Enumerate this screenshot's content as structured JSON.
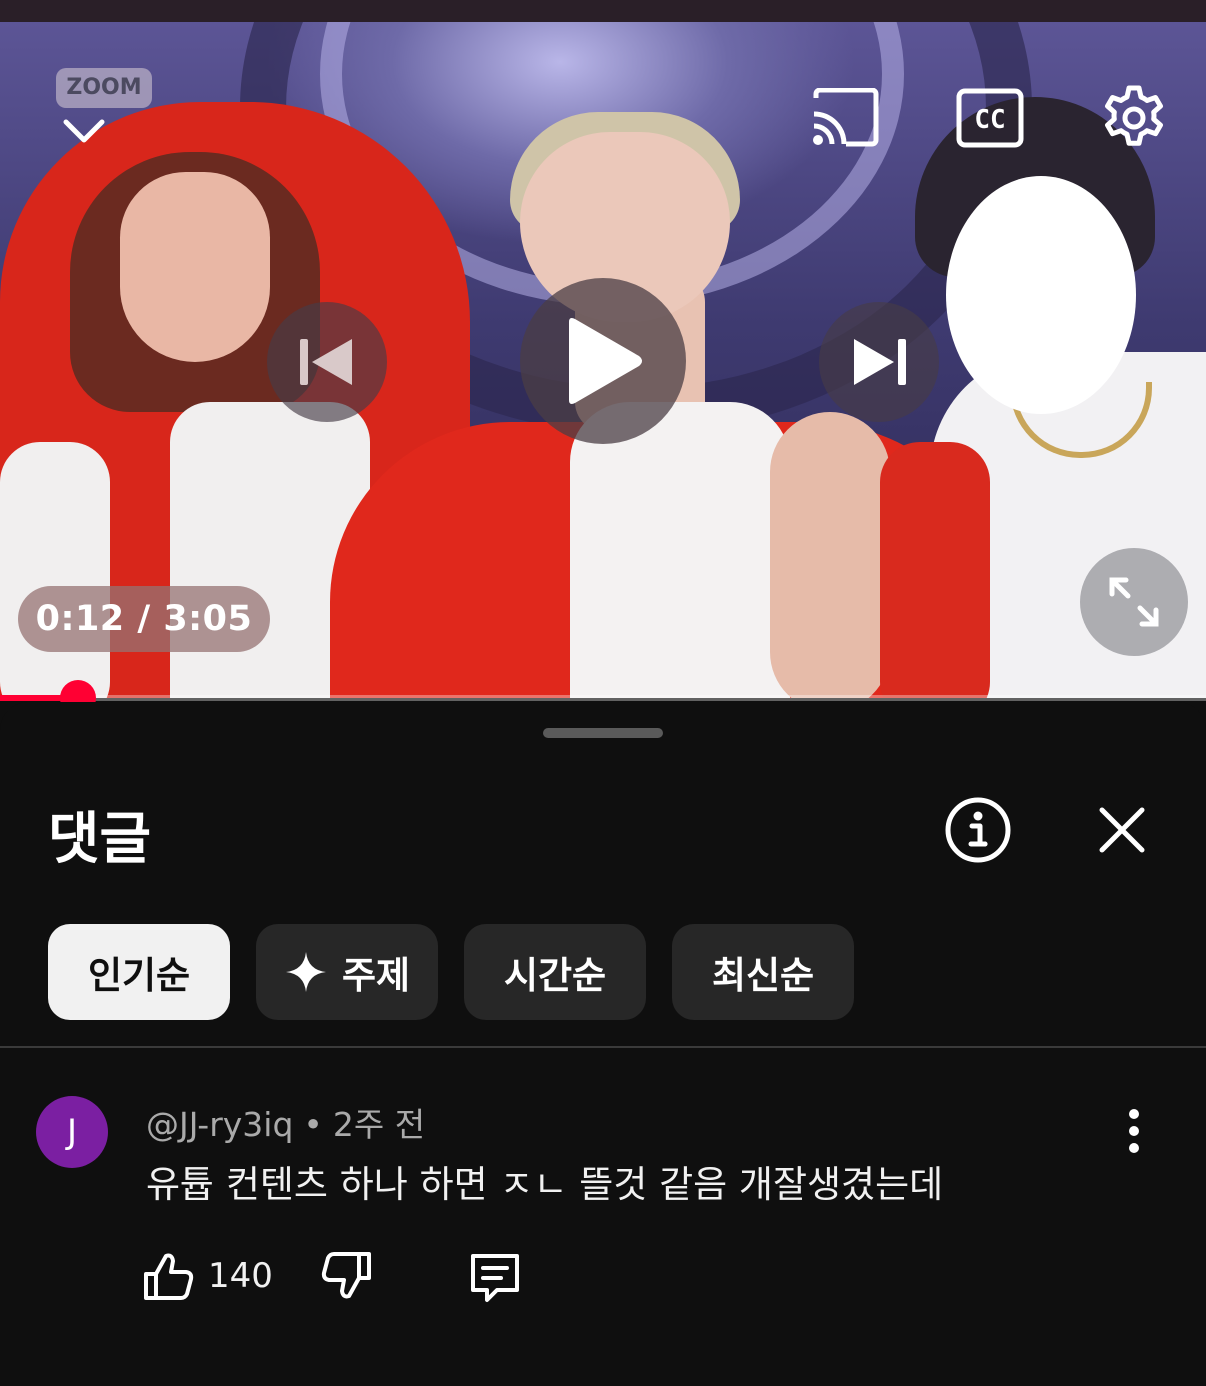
{
  "player": {
    "zoom_badge": "ZOOM",
    "time_display": "0:12 / 3:05",
    "progress": 0.065,
    "accent_color": "#ff0033",
    "controls": [
      "chevron-down-icon",
      "cast-icon",
      "captions-icon",
      "settings-gear-icon",
      "previous-icon",
      "play-icon",
      "next-icon",
      "fullscreen-icon"
    ],
    "captions_label": "CC"
  },
  "comments_panel": {
    "title": "댓글",
    "chips": [
      {
        "label": "인기순",
        "active": true
      },
      {
        "label": "주제",
        "active": false,
        "icon": "sparkle-icon"
      },
      {
        "label": "시간순",
        "active": false
      },
      {
        "label": "최신순",
        "active": false
      }
    ],
    "comments": [
      {
        "avatar_letter": "J",
        "avatar_color": "#7b1fa2",
        "author": "@JJ-ry3iq",
        "separator": "•",
        "time": "2주 전",
        "text": "유튭 컨텐츠 하나 하면 ㅈㄴ 뜰것 같음 개잘생겼는데",
        "likes": "140"
      }
    ]
  }
}
